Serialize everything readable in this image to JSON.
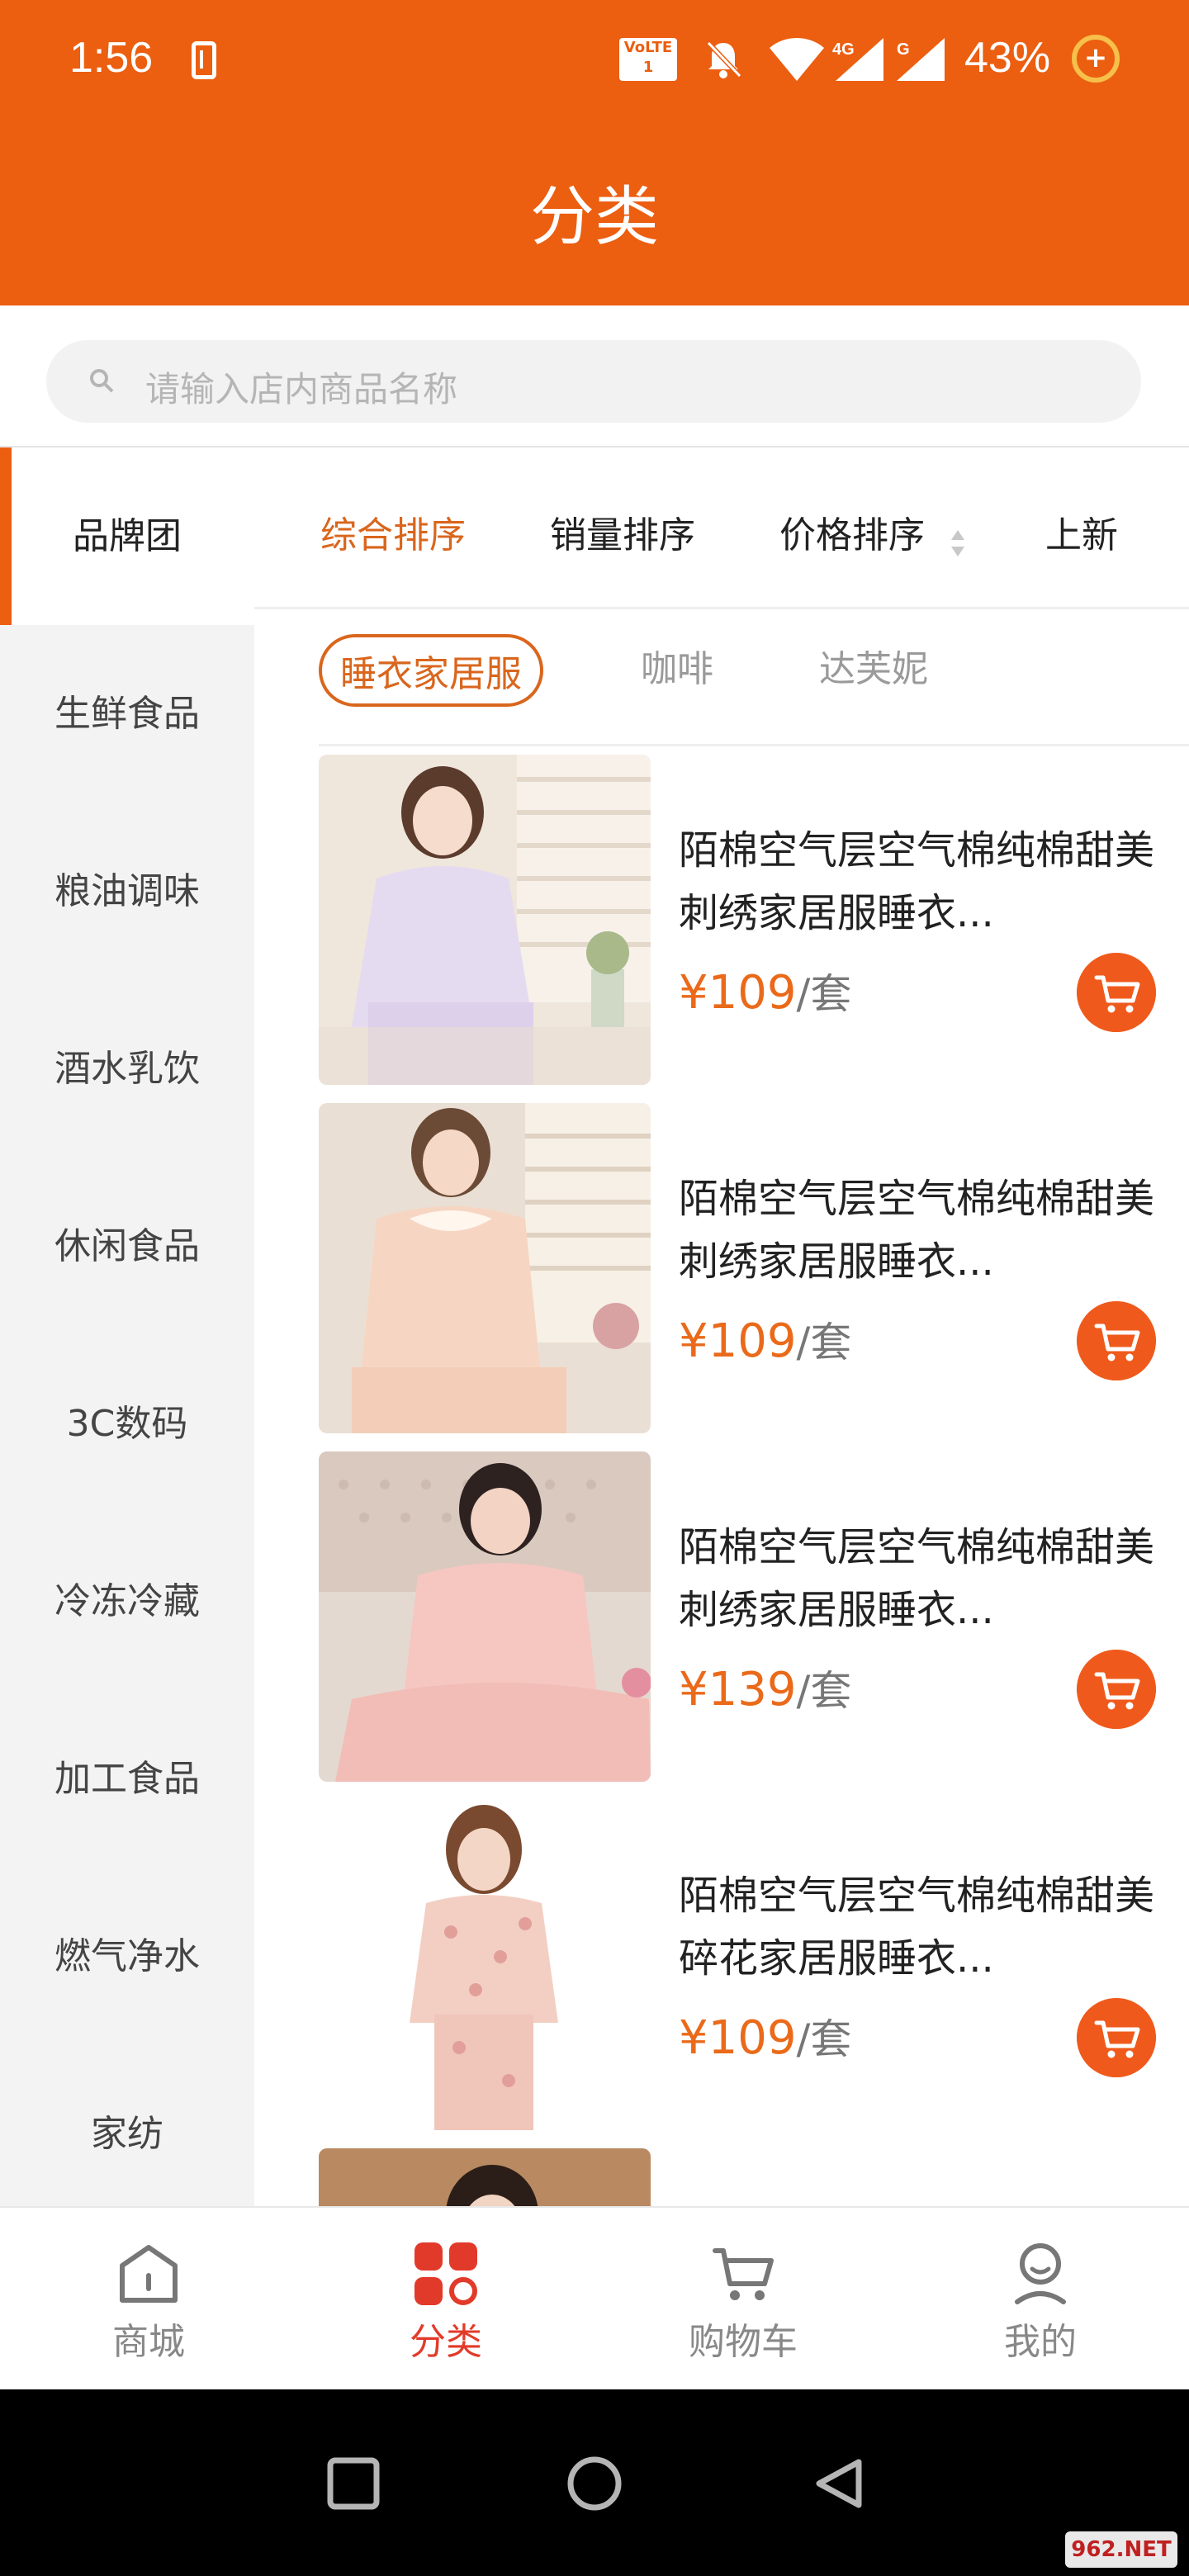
{
  "status_bar": {
    "time": "1:56",
    "network": "4G",
    "battery": "43%",
    "lte_label": "VoLTE 1"
  },
  "header": {
    "title": "分类"
  },
  "search": {
    "placeholder": "请输入店内商品名称"
  },
  "sidebar": {
    "items": [
      {
        "label": "品牌团",
        "active": true
      },
      {
        "label": "生鲜食品"
      },
      {
        "label": "粮油调味"
      },
      {
        "label": "酒水乳饮"
      },
      {
        "label": "休闲食品"
      },
      {
        "label": "3C数码"
      },
      {
        "label": "冷冻冷藏"
      },
      {
        "label": "加工食品"
      },
      {
        "label": "燃气净水"
      },
      {
        "label": "家纺"
      }
    ]
  },
  "sort_bar": {
    "items": [
      {
        "label": "综合排序",
        "active": true
      },
      {
        "label": "销量排序"
      },
      {
        "label": "价格排序"
      },
      {
        "label": "上新"
      }
    ]
  },
  "sub_tabs": [
    {
      "label": "睡衣家居服",
      "active": true
    },
    {
      "label": "咖啡"
    },
    {
      "label": "达芙妮"
    }
  ],
  "products": [
    {
      "title": "陌棉空气层空气棉纯棉甜美刺绣家居服睡衣...",
      "price": "¥109",
      "unit": "/套"
    },
    {
      "title": "陌棉空气层空气棉纯棉甜美刺绣家居服睡衣...",
      "price": "¥109",
      "unit": "/套"
    },
    {
      "title": "陌棉空气层空气棉纯棉甜美刺绣家居服睡衣...",
      "price": "¥139",
      "unit": "/套"
    },
    {
      "title": "陌棉空气层空气棉纯棉甜美碎花家居服睡衣...",
      "price": "¥109",
      "unit": "/套"
    }
  ],
  "bottom_nav": {
    "items": [
      {
        "label": "商城",
        "icon": "home-icon"
      },
      {
        "label": "分类",
        "icon": "category-icon",
        "active": true
      },
      {
        "label": "购物车",
        "icon": "cart-icon"
      },
      {
        "label": "我的",
        "icon": "profile-icon"
      }
    ]
  },
  "watermark": {
    "text": "962.NET"
  },
  "colors": {
    "brand": "#ec5e10",
    "accent_text": "#d9661d",
    "active_nav": "#e23a2a"
  }
}
